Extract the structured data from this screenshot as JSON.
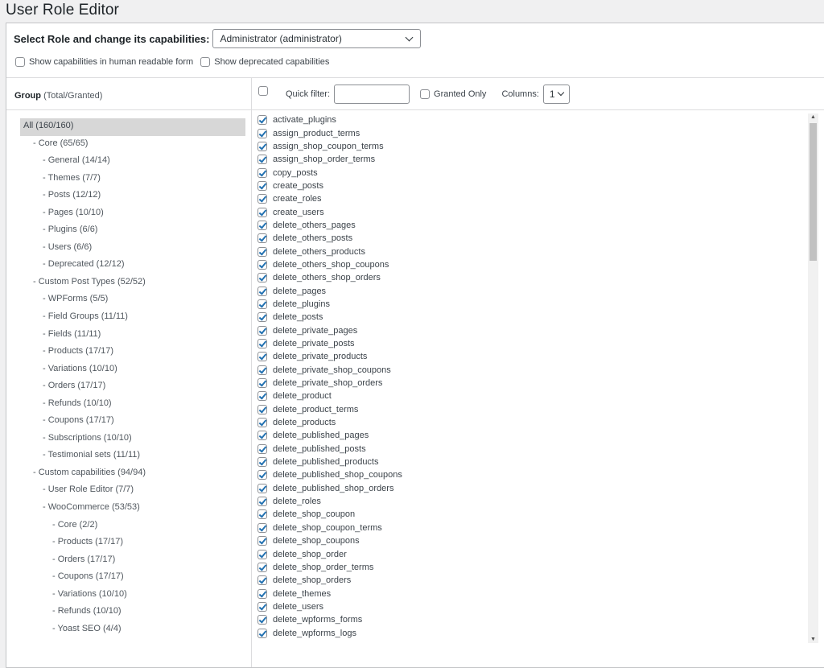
{
  "title": "User Role Editor",
  "role_selector": {
    "label": "Select Role and change its capabilities:",
    "selected": "Administrator (administrator)"
  },
  "options": {
    "human_readable": "Show capabilities in human readable form",
    "deprecated": "Show deprecated capabilities"
  },
  "group_header": {
    "label": "Group",
    "hint": "(Total/Granted)"
  },
  "toolbar": {
    "quick_filter_label": "Quick filter:",
    "quick_filter_value": "",
    "granted_only_label": "Granted Only",
    "columns_label": "Columns:",
    "columns_value": "1"
  },
  "groups": [
    {
      "label": "All (160/160)",
      "level": 0,
      "selected": true
    },
    {
      "label": "- Core (65/65)",
      "level": 1
    },
    {
      "label": "- General (14/14)",
      "level": 2
    },
    {
      "label": "- Themes (7/7)",
      "level": 2
    },
    {
      "label": "- Posts (12/12)",
      "level": 2
    },
    {
      "label": "- Pages (10/10)",
      "level": 2
    },
    {
      "label": "- Plugins (6/6)",
      "level": 2
    },
    {
      "label": "- Users (6/6)",
      "level": 2
    },
    {
      "label": "- Deprecated (12/12)",
      "level": 2
    },
    {
      "label": "- Custom Post Types (52/52)",
      "level": 1
    },
    {
      "label": "- WPForms (5/5)",
      "level": 2
    },
    {
      "label": "- Field Groups (11/11)",
      "level": 2
    },
    {
      "label": "- Fields (11/11)",
      "level": 2
    },
    {
      "label": "- Products (17/17)",
      "level": 2
    },
    {
      "label": "- Variations (10/10)",
      "level": 2
    },
    {
      "label": "- Orders (17/17)",
      "level": 2
    },
    {
      "label": "- Refunds (10/10)",
      "level": 2
    },
    {
      "label": "- Coupons (17/17)",
      "level": 2
    },
    {
      "label": "- Subscriptions (10/10)",
      "level": 2
    },
    {
      "label": "- Testimonial sets (11/11)",
      "level": 2
    },
    {
      "label": "- Custom capabilities (94/94)",
      "level": 1
    },
    {
      "label": "- User Role Editor (7/7)",
      "level": 2
    },
    {
      "label": "- WooCommerce (53/53)",
      "level": 2
    },
    {
      "label": "- Core (2/2)",
      "level": 3
    },
    {
      "label": "- Products (17/17)",
      "level": 3
    },
    {
      "label": "- Orders (17/17)",
      "level": 3
    },
    {
      "label": "- Coupons (17/17)",
      "level": 3
    },
    {
      "label": "- Variations (10/10)",
      "level": 3
    },
    {
      "label": "- Refunds (10/10)",
      "level": 3
    },
    {
      "label": "- Yoast SEO (4/4)",
      "level": 3
    }
  ],
  "capabilities": [
    "activate_plugins",
    "assign_product_terms",
    "assign_shop_coupon_terms",
    "assign_shop_order_terms",
    "copy_posts",
    "create_posts",
    "create_roles",
    "create_users",
    "delete_others_pages",
    "delete_others_posts",
    "delete_others_products",
    "delete_others_shop_coupons",
    "delete_others_shop_orders",
    "delete_pages",
    "delete_plugins",
    "delete_posts",
    "delete_private_pages",
    "delete_private_posts",
    "delete_private_products",
    "delete_private_shop_coupons",
    "delete_private_shop_orders",
    "delete_product",
    "delete_product_terms",
    "delete_products",
    "delete_published_pages",
    "delete_published_posts",
    "delete_published_products",
    "delete_published_shop_coupons",
    "delete_published_shop_orders",
    "delete_roles",
    "delete_shop_coupon",
    "delete_shop_coupon_terms",
    "delete_shop_coupons",
    "delete_shop_order",
    "delete_shop_order_terms",
    "delete_shop_orders",
    "delete_themes",
    "delete_users",
    "delete_wpforms_forms",
    "delete_wpforms_logs"
  ],
  "colors": {
    "accent": "#2271b1",
    "selected_group_bg": "#d7d7d7",
    "border": "#dcdcde"
  }
}
